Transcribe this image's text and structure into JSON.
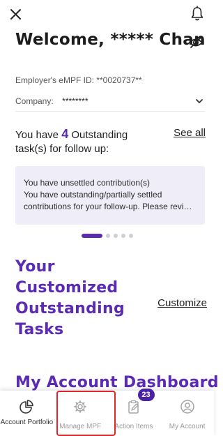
{
  "header": {
    "welcome_title": "Welcome, ***** Chan",
    "icons": {
      "close": "close-icon",
      "notifications": "bell-icon",
      "hide_sensitive": "eye-slash-icon"
    }
  },
  "account": {
    "employer_id_text": "Employer's eMPF ID: **0020737**",
    "company_label": "Company:",
    "company_value": "********"
  },
  "tasks": {
    "prefix": "You have ",
    "count": "4",
    "suffix": " Outstanding task(s) for follow up:",
    "see_all": "See all",
    "card_lines": [
      "You have unsettled contribution(s)",
      "You have outstanding/partially settled",
      "contributions for your follow-up. Please revi…"
    ],
    "pager_active_index": 0,
    "pager_total": 5
  },
  "customized": {
    "title": "Your Customized Outstanding Tasks",
    "customize_link": "Customize"
  },
  "dashboard": {
    "title": "My Account Dashboard"
  },
  "bottom_nav": {
    "items": [
      {
        "label": "Account Portfolio",
        "icon": "pie-chart-icon",
        "enabled": true
      },
      {
        "label": "Manage MPF",
        "icon": "gear-icon",
        "enabled": false
      },
      {
        "label": "Action Items",
        "icon": "clipboard-edit-icon",
        "enabled": false,
        "badge": "23"
      },
      {
        "label": "My Account",
        "icon": "user-circle-icon",
        "enabled": false
      }
    ],
    "highlighted_item": "Manage MPF"
  },
  "colors": {
    "accent": "#5b2bb4",
    "card_bg": "#efedf8",
    "highlight_border": "#e3252b",
    "badge_bg": "#4a23a5"
  }
}
